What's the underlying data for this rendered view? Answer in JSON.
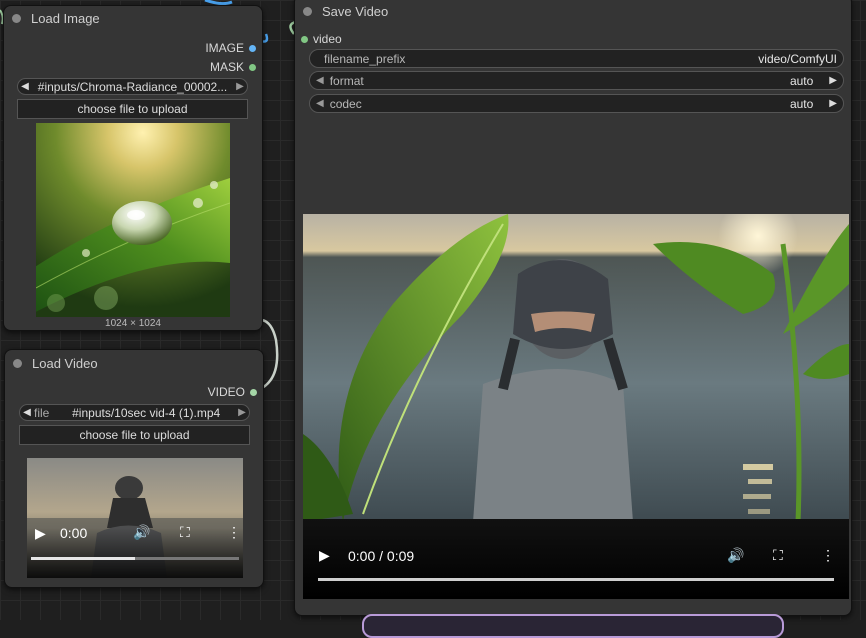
{
  "load_image": {
    "title": "Load Image",
    "outputs": {
      "image": "IMAGE",
      "mask": "MASK"
    },
    "image_selector": "#inputs/Chroma-Radiance_00002...",
    "upload_label": "choose file to upload",
    "image_size": "1024 × 1024"
  },
  "load_video": {
    "title": "Load Video",
    "output": "VIDEO",
    "file_label": "file",
    "file_value": "#inputs/10sec vid-4 (1).mp4",
    "upload_label": "choose file to upload",
    "player": {
      "time": "0:00",
      "progress": 0.5
    }
  },
  "save_video": {
    "title": "Save Video",
    "input_label": "video",
    "widgets": {
      "filename_prefix": {
        "label": "filename_prefix",
        "value": "video/ComfyUI"
      },
      "format": {
        "label": "format",
        "value": "auto"
      },
      "codec": {
        "label": "codec",
        "value": "auto"
      }
    },
    "player": {
      "time": "0:00 / 0:09",
      "progress": 0.0
    }
  },
  "colors": {
    "image_slot": "#64b5f6",
    "mask_slot": "#81c784",
    "video_slot": "#a5d6a7",
    "link_blue": "#4aa3f0"
  }
}
